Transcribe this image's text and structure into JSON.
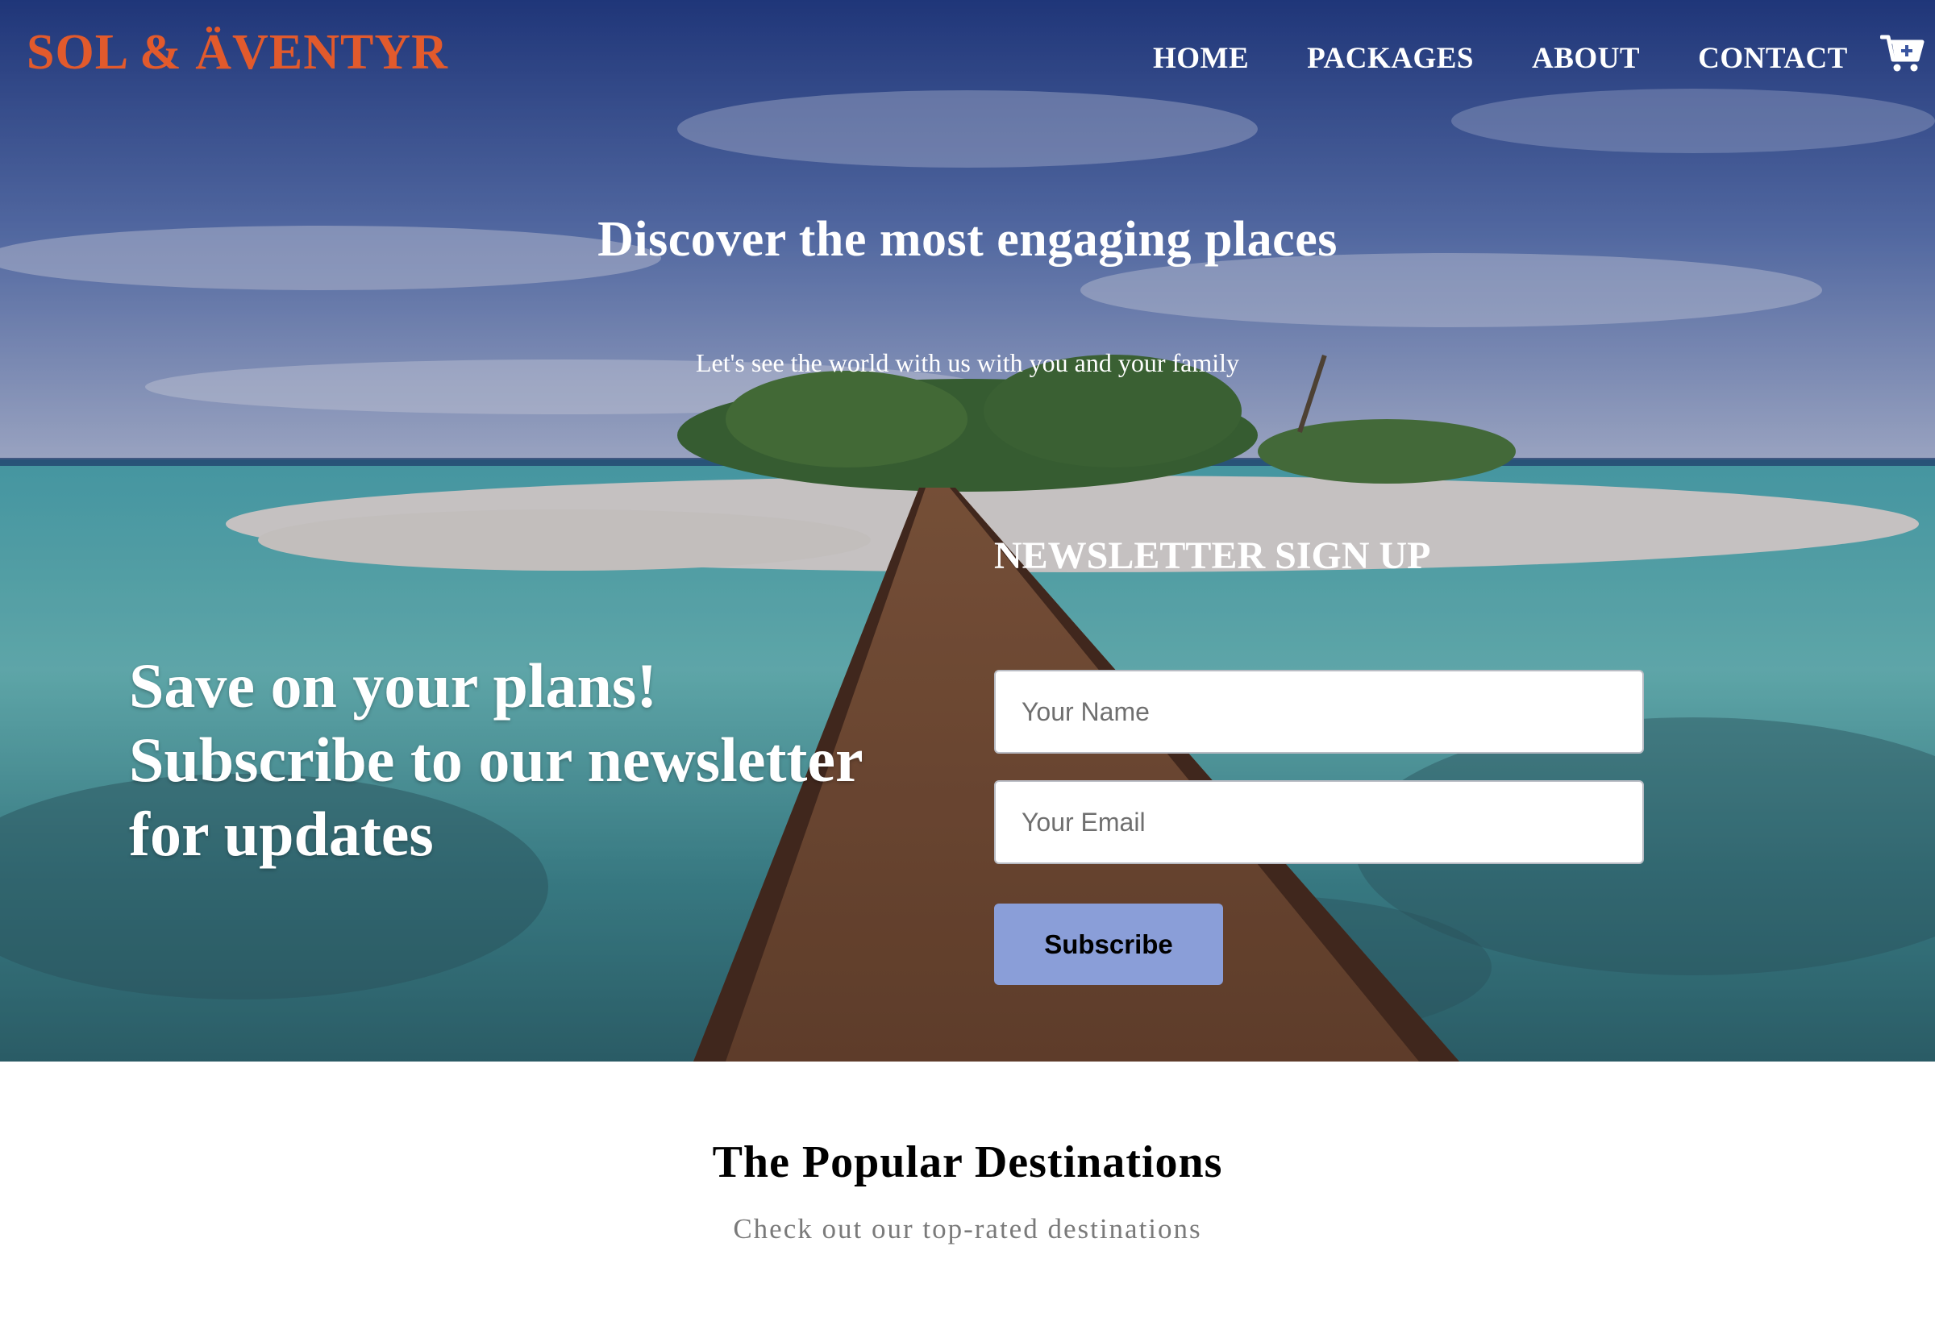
{
  "brand": {
    "name": "SOL & ÄVENTYR",
    "color": "#e25a2c"
  },
  "nav": {
    "items": [
      {
        "label": "HOME"
      },
      {
        "label": "PACKAGES"
      },
      {
        "label": "ABOUT"
      },
      {
        "label": "CONTACT"
      }
    ],
    "cart_icon": "cart-plus-icon"
  },
  "hero": {
    "title": "Discover the most engaging places",
    "subtitle": "Let's see the world with us with you and your family"
  },
  "promo": {
    "line1": "Save on your plans!",
    "line2": "Subscribe to our newsletter",
    "line3": "for updates"
  },
  "newsletter": {
    "title": "NEWSLETTER SIGN UP",
    "name_placeholder": "Your Name",
    "email_placeholder": "Your Email",
    "submit_label": "Subscribe",
    "button_color": "#8a9ed8"
  },
  "popular": {
    "title": "The Popular Destinations",
    "subtitle": "Check out our top-rated destinations"
  }
}
